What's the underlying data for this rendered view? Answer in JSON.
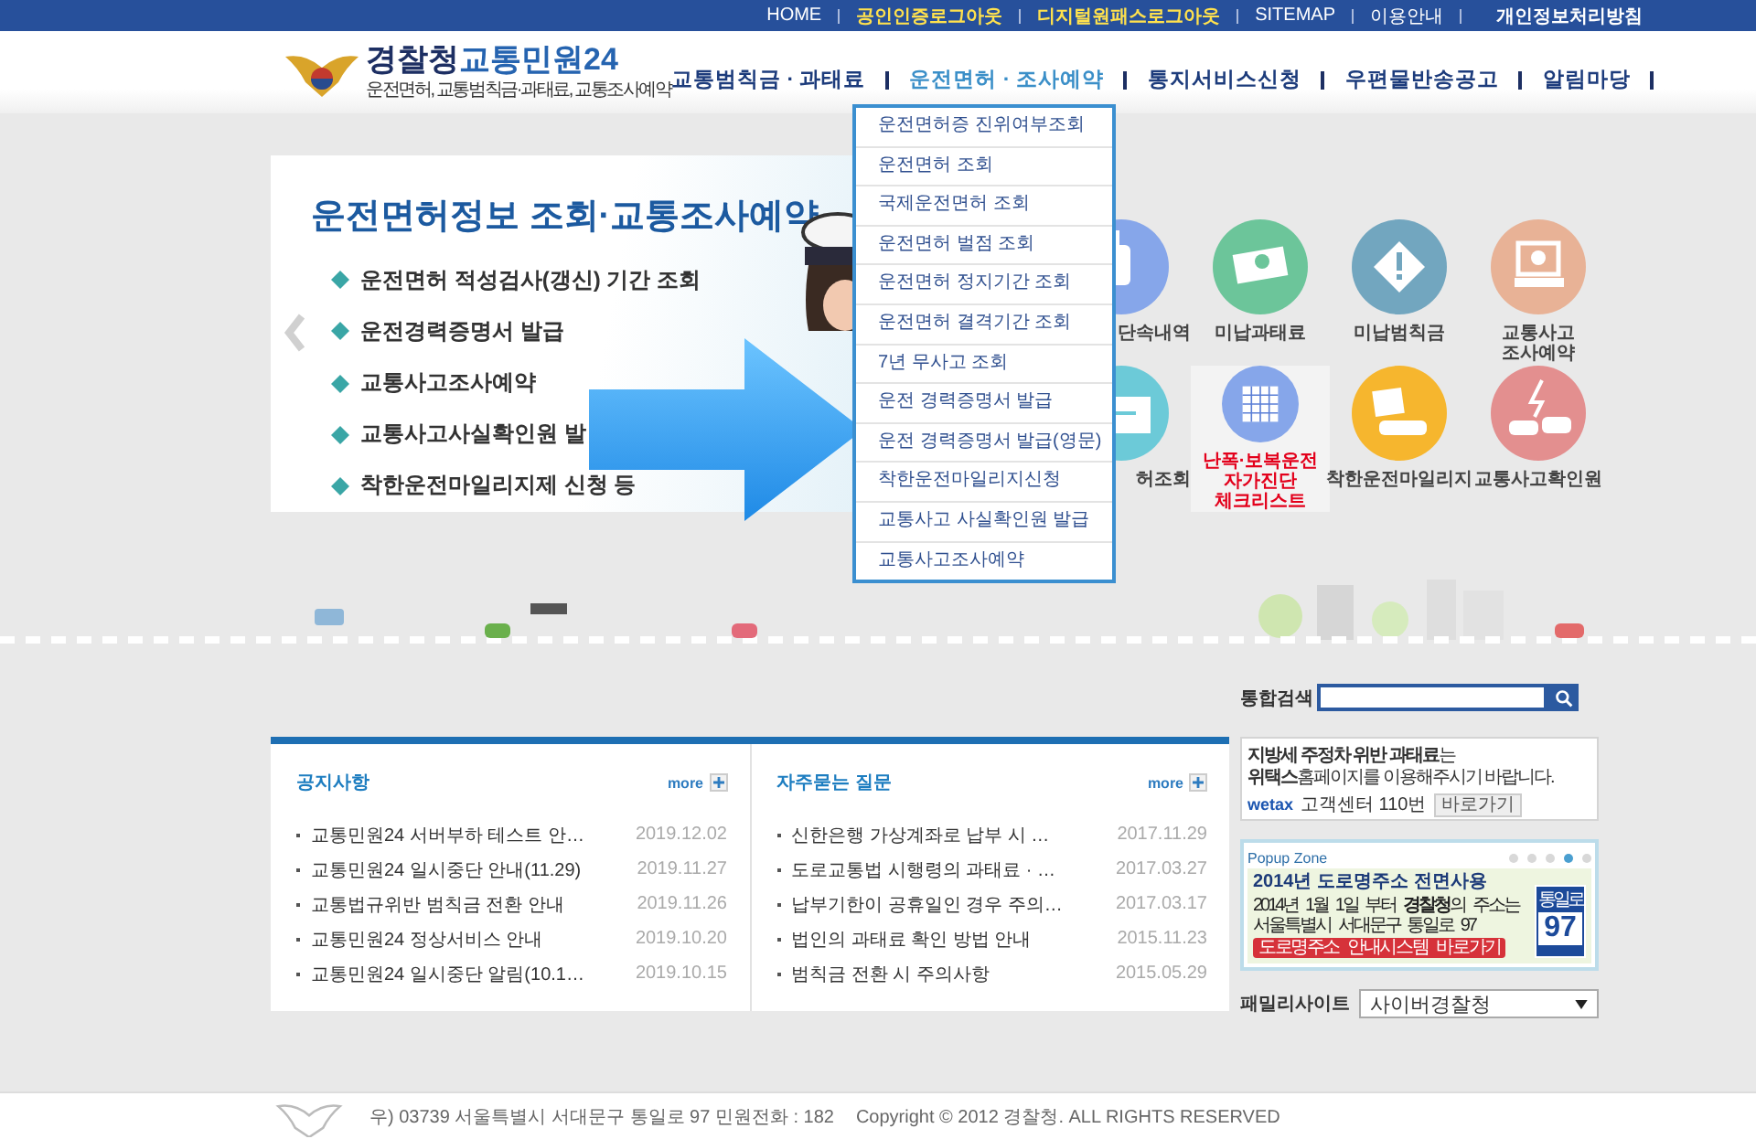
{
  "top_links": [
    {
      "label": "HOME",
      "kind": "plain"
    },
    {
      "label": "공인인증로그아웃",
      "kind": "accent"
    },
    {
      "label": "디지털원패스로그아웃",
      "kind": "accent"
    },
    {
      "label": "SITEMAP",
      "kind": "plain"
    },
    {
      "label": "이용안내",
      "kind": "plain"
    },
    {
      "label": "개인정보처리방침",
      "kind": "bold"
    }
  ],
  "logo": {
    "title_main": "경찰청",
    "title_sub": "교통민원24",
    "tagline": "운전면허, 교통범칙금·과태료, 교통조사예약"
  },
  "nav": [
    {
      "label": "교통범칙금 · 과태료",
      "selected": false
    },
    {
      "label": "운전면허 · 조사예약",
      "selected": true,
      "submenu": [
        "운전면허증 진위여부조회",
        "운전면허 조회",
        "국제운전면허 조회",
        "운전면허 벌점 조회",
        "운전면허 정지기간 조회",
        "운전면허 결격기간 조회",
        "7년 무사고 조회",
        "운전 경력증명서 발급",
        "운전 경력증명서 발급(영문)",
        "착한운전마일리지신청",
        "교통사고 사실확인원 발급",
        "교통사고조사예약"
      ]
    },
    {
      "label": "통지서비스신청",
      "selected": false
    },
    {
      "label": "우편물반송공고",
      "selected": false
    },
    {
      "label": "알림마당",
      "selected": false
    }
  ],
  "hero": {
    "title": "운전면허정보 조회·교통조사예약",
    "items": [
      "운전면허 적성검사(갱신) 기간 조회",
      "운전경력증명서 발급",
      "교통사고조사예약",
      "교통사고사실확인원 발",
      "착한운전마일리지제 신청 등"
    ]
  },
  "quick_icons": [
    {
      "label": "단속내역",
      "kind": "normal"
    },
    {
      "label": "미납과태료",
      "kind": "normal"
    },
    {
      "label": "미납범칙금",
      "kind": "normal"
    },
    {
      "label": "교통사고\n조사예약",
      "kind": "normal"
    },
    {
      "label": "허조회",
      "kind": "normal"
    },
    {
      "label": "난폭·보복운전\n자가진단\n체크리스트",
      "kind": "alert"
    },
    {
      "label": "착한운전마일리지",
      "kind": "normal"
    },
    {
      "label": "교통사고확인원",
      "kind": "normal"
    }
  ],
  "search": {
    "label": "통합검색"
  },
  "boards": [
    {
      "title": "공지사항",
      "more": "more",
      "items": [
        {
          "text": "교통민원24 서버부하 테스트 안…",
          "date": "2019.12.02"
        },
        {
          "text": "교통민원24 일시중단 안내(11.29)",
          "date": "2019.11.27"
        },
        {
          "text": "교통법규위반 범칙금 전환 안내",
          "date": "2019.11.26"
        },
        {
          "text": "교통민원24 정상서비스 안내",
          "date": "2019.10.20"
        },
        {
          "text": "교통민원24 일시중단 알림(10.1…",
          "date": "2019.10.15"
        }
      ]
    },
    {
      "title": "자주묻는 질문",
      "more": "more",
      "items": [
        {
          "text": "신한은행 가상계좌로 납부 시 …",
          "date": "2017.11.29"
        },
        {
          "text": "도로교통법 시행령의 과태료 · …",
          "date": "2017.03.27"
        },
        {
          "text": "납부기한이 공휴일인 경우 주의…",
          "date": "2017.03.17"
        },
        {
          "text": "법인의 과태료 확인 방법 안내",
          "date": "2015.11.23"
        },
        {
          "text": "범칙금 전환 시 주의사항",
          "date": "2015.05.29"
        }
      ]
    }
  ],
  "ad_banner": {
    "line1": "**지방세 주정차 위반 과태료**는",
    "line2": "**위택스**홈페이지를 이용해주시기 바랍니다.",
    "logo": "wetax",
    "phone": "고객센터 110번",
    "button": "바로가기"
  },
  "popup_zone": {
    "title": "Popup Zone",
    "dots": [
      {
        "selected": false
      },
      {
        "selected": false
      },
      {
        "selected": false
      },
      {
        "selected": true
      },
      {
        "selected": false
      }
    ],
    "headline": "2014년 **도로명주소** 전면사용",
    "line1": "2014년 1월 1일 부터 **경찰청**의 주소는",
    "line2": "서울특별시 서대문구 통일로 97",
    "button": "도로명주소 안내시스템 바로가기",
    "sign_top": "통일로",
    "sign_number": "97"
  },
  "family_site": {
    "label": "패밀리사이트",
    "value": "사이버경찰청"
  },
  "footer": {
    "address": "우) 03739 서울특별시 서대문구 통일로 97 민원전화 : 182",
    "copyright": "Copyright © 2012 경찰청. ALL RIGHTS RESERVED"
  }
}
